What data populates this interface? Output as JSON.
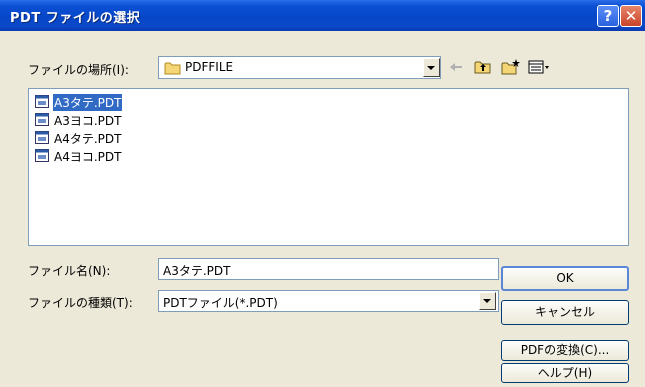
{
  "window": {
    "title": "PDT ファイルの選択",
    "help_button": "?",
    "close_button": "✕"
  },
  "look_in": {
    "label": "ファイルの場所(I):",
    "value": "PDFFILE"
  },
  "toolbar": {
    "back_icon": "back-arrow-icon",
    "up_icon": "up-folder-icon",
    "new_folder_icon": "new-folder-icon",
    "view_icon": "view-menu-icon"
  },
  "files": [
    {
      "name": "A3タテ.PDT",
      "selected": true
    },
    {
      "name": "A3ヨコ.PDT",
      "selected": false
    },
    {
      "name": "A4タテ.PDT",
      "selected": false
    },
    {
      "name": "A4ヨコ.PDT",
      "selected": false
    }
  ],
  "file_name": {
    "label": "ファイル名(N):",
    "value": "A3タテ.PDT"
  },
  "file_type": {
    "label": "ファイルの種類(T):",
    "value": "PDTファイル(*.PDT)"
  },
  "buttons": {
    "ok": "OK",
    "cancel": "キャンセル",
    "convert": "PDFの変換(C)...",
    "help": "ヘルプ(H)"
  },
  "colors": {
    "title_bar": "#0a4fd4",
    "dialog_bg": "#ece9d8",
    "selection": "#316ac5"
  }
}
